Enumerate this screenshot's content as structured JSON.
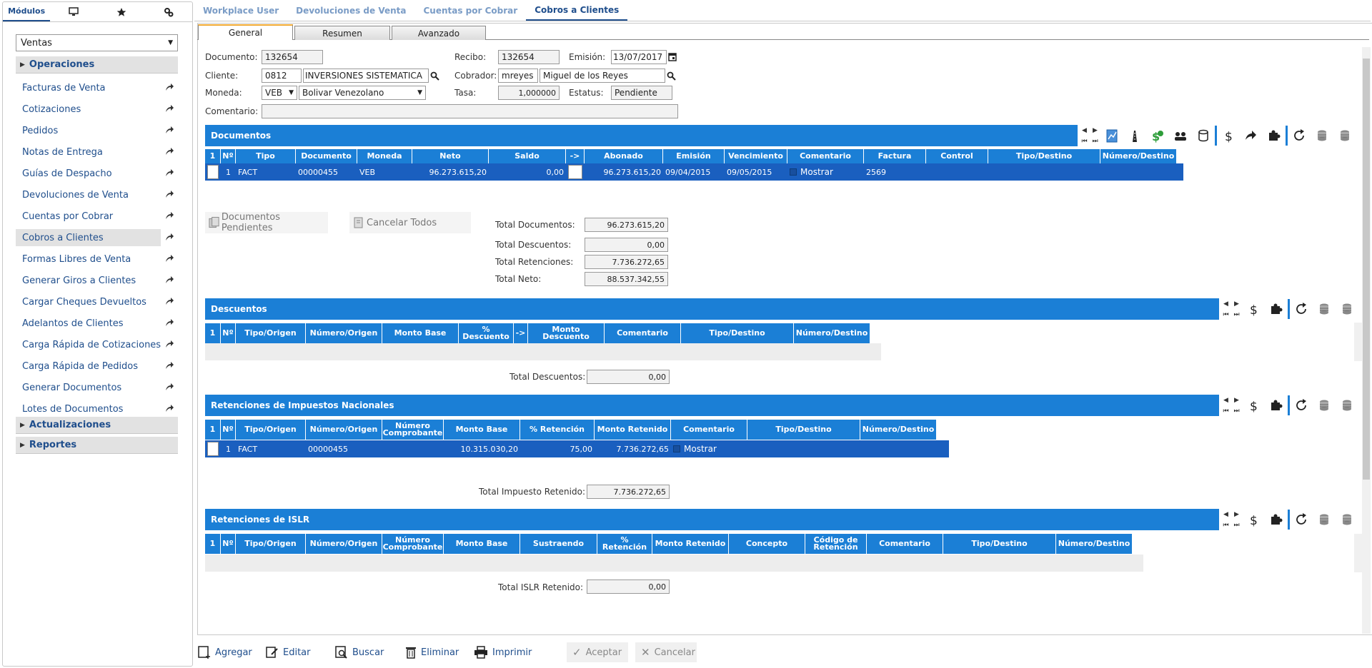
{
  "sidebar": {
    "tabs": [
      {
        "label": "Módulos",
        "icon": ""
      },
      {
        "label": "",
        "icon": "monitor-icon"
      },
      {
        "label": "",
        "icon": "star-icon"
      },
      {
        "label": "",
        "icon": "gears-icon"
      }
    ],
    "module_select": "Ventas",
    "sections": {
      "operaciones": "Operaciones",
      "actualizaciones": "Actualizaciones",
      "reportes": "Reportes"
    },
    "items": [
      "Facturas de Venta",
      "Cotizaciones",
      "Pedidos",
      "Notas de Entrega",
      "Guías de Despacho",
      "Devoluciones de Venta",
      "Cuentas por Cobrar",
      "Cobros a Clientes",
      "Formas Libres de Venta",
      "Generar Giros a Clientes",
      "Cargar Cheques Devueltos",
      "Adelantos de Clientes",
      "Carga Rápida de Cotizaciones",
      "Carga Rápida de Pedidos",
      "Generar Documentos",
      "Lotes de Documentos"
    ],
    "active_item": "Cobros a Clientes"
  },
  "top_tabs": [
    "Workplace User",
    "Devoluciones de Venta",
    "Cuentas por Cobrar",
    "Cobros a Clientes"
  ],
  "sub_tabs": [
    "General",
    "Resumen",
    "Avanzado"
  ],
  "form": {
    "documento_label": "Documento:",
    "documento": "132654",
    "recibo_label": "Recibo:",
    "recibo": "132654",
    "emision_label": "Emisión:",
    "emision": "13/07/2017",
    "cliente_label": "Cliente:",
    "cliente_code": "0812",
    "cliente_name": "INVERSIONES SISTEMATICA",
    "cobrador_label": "Cobrador:",
    "cobrador_code": "mreyes",
    "cobrador_name": "Miguel de los Reyes",
    "moneda_label": "Moneda:",
    "moneda_code": "VEB",
    "moneda_name": "Bolivar Venezolano",
    "tasa_label": "Tasa:",
    "tasa": "1,000000",
    "estatus_label": "Estatus:",
    "estatus": "Pendiente",
    "comentario_label": "Comentario:",
    "comentario": ""
  },
  "documentos": {
    "title": "Documentos",
    "columns": [
      "1",
      "Nº",
      "Tipo",
      "Documento",
      "Moneda",
      "Neto",
      "Saldo",
      "->",
      "Abonado",
      "Emisión",
      "Vencimiento",
      "Comentario",
      "Factura",
      "Control",
      "Tipo/Destino",
      "Número/Destino"
    ],
    "row": {
      "n": "1",
      "tipo": "FACT",
      "documento": "00000455",
      "moneda": "VEB",
      "neto": "96.273.615,20",
      "saldo": "0,00",
      "abonado": "96.273.615,20",
      "emision": "09/04/2015",
      "vencimiento": "09/05/2015",
      "comentario": "Mostrar",
      "factura": "2569"
    },
    "btn_pendientes": "Documentos Pendientes",
    "btn_cancelar": "Cancelar Todos",
    "totals": [
      {
        "label": "Total Documentos:",
        "value": "96.273.615,20"
      },
      {
        "label": "Total Descuentos:",
        "value": "0,00"
      },
      {
        "label": "Total Retenciones:",
        "value": "7.736.272,65"
      },
      {
        "label": "Total Neto:",
        "value": "88.537.342,55"
      }
    ]
  },
  "descuentos": {
    "title": "Descuentos",
    "columns": [
      "1",
      "Nº",
      "Tipo/Origen",
      "Número/Origen",
      "Monto Base",
      "% Descuento",
      "->",
      "Monto Descuento",
      "Comentario",
      "Tipo/Destino",
      "Número/Destino"
    ],
    "total_label": "Total Descuentos:",
    "total": "0,00"
  },
  "retenciones": {
    "title": "Retenciones de Impuestos Nacionales",
    "columns": [
      "1",
      "Nº",
      "Tipo/Origen",
      "Número/Origen",
      "Número Comprobante",
      "Monto Base",
      "% Retención",
      "Monto Retenido",
      "Comentario",
      "Tipo/Destino",
      "Número/Destino"
    ],
    "row": {
      "n": "1",
      "tipo": "FACT",
      "numero": "00000455",
      "monto_base": "10.315.030,20",
      "pct": "75,00",
      "retenido": "7.736.272,65",
      "comentario": "Mostrar"
    },
    "total_label": "Total Impuesto Retenido:",
    "total": "7.736.272,65"
  },
  "islr": {
    "title": "Retenciones de ISLR",
    "columns": [
      "1",
      "Nº",
      "Tipo/Origen",
      "Número/Origen",
      "Número Comprobante",
      "Monto Base",
      "Sustraendo",
      "% Retención",
      "Monto Retenido",
      "Concepto",
      "Código de Retención",
      "Comentario",
      "Tipo/Destino",
      "Número/Destino"
    ],
    "total_label": "Total ISLR Retenido:",
    "total": "0,00"
  },
  "bottom": {
    "agregar": "Agregar",
    "editar": "Editar",
    "buscar": "Buscar",
    "eliminar": "Eliminar",
    "imprimir": "Imprimir",
    "aceptar": "Aceptar",
    "cancelar": "Cancelar"
  },
  "colors": {
    "accent": "#1b7fd6",
    "row": "#1a5fbf",
    "nav_text": "#1f4e8c"
  }
}
